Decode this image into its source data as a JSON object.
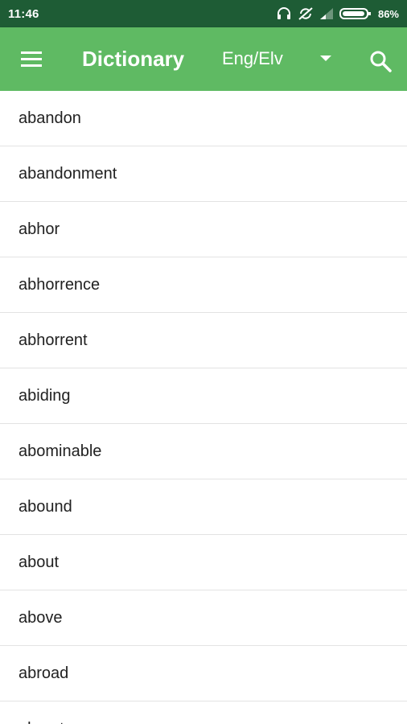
{
  "status_bar": {
    "time": "11:46",
    "battery_percent": "86%",
    "icons": [
      "headphones-icon",
      "sync-off-icon",
      "signal-icon",
      "battery-icon"
    ]
  },
  "app_bar": {
    "title": "Dictionary",
    "language": "Eng/Elv",
    "background_color": "#5fba63",
    "menu_icon": "hamburger-menu-icon",
    "dropdown_icon": "dropdown-caret-icon",
    "search_icon": "search-icon"
  },
  "words": [
    "abandon",
    "abandonment",
    "abhor",
    "abhorrence",
    "abhorrent",
    "abiding",
    "abominable",
    "abound",
    "about",
    "above",
    "abroad",
    "abrupt"
  ]
}
